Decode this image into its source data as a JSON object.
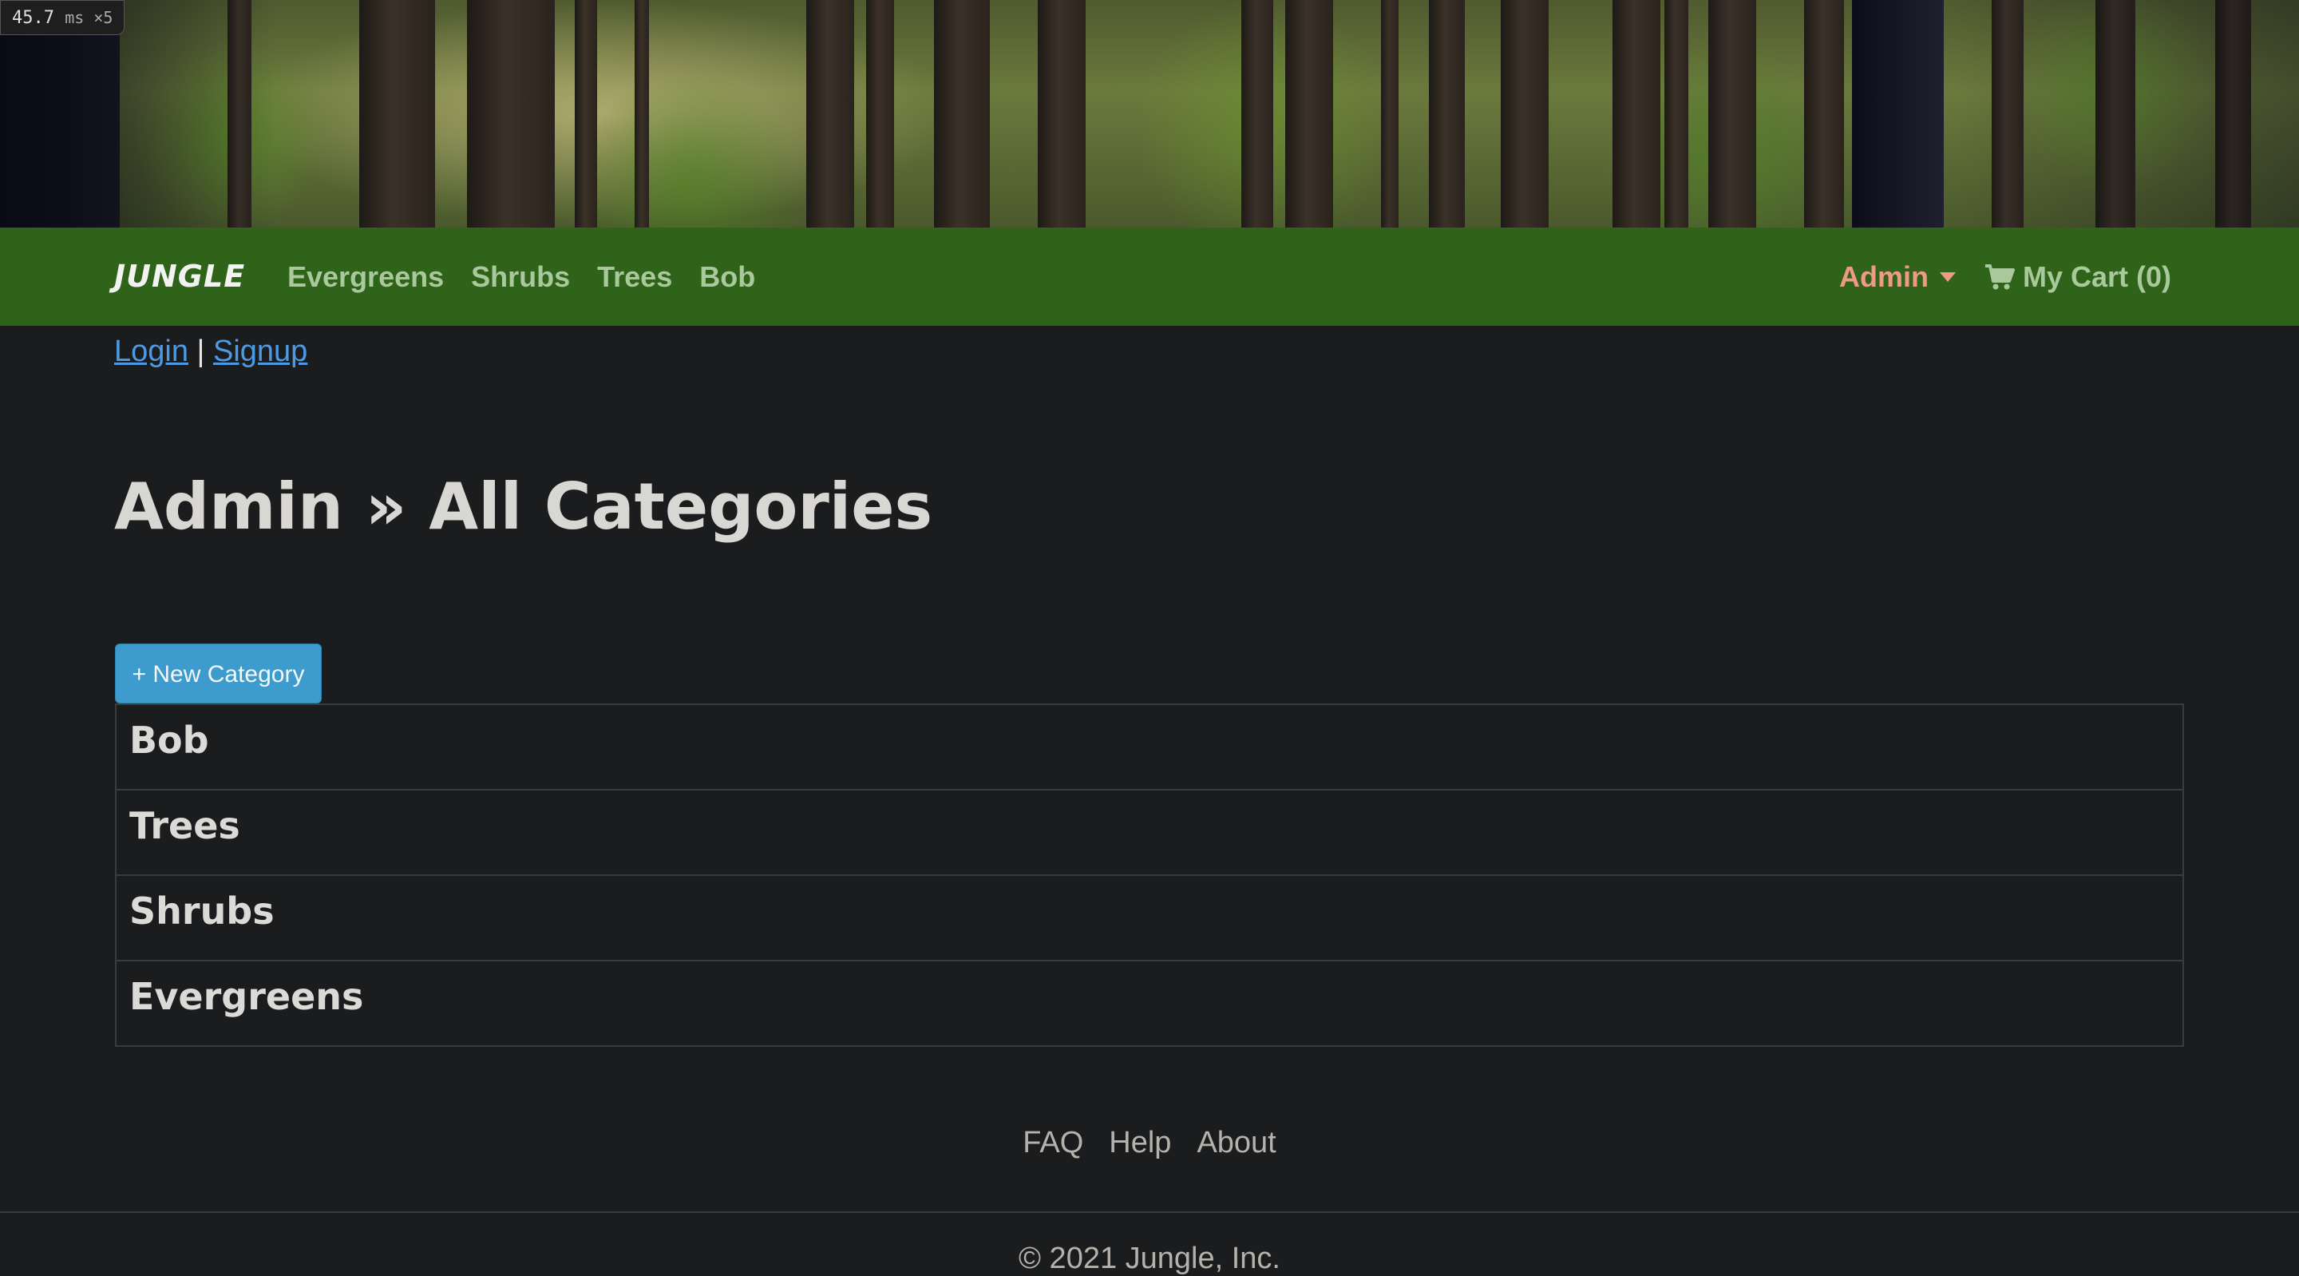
{
  "perf": {
    "value": "45.7",
    "unit": "ms ×5"
  },
  "navbar": {
    "brand": "JUNGLE",
    "links": [
      "Evergreens",
      "Shrubs",
      "Trees",
      "Bob"
    ],
    "admin_label": "Admin",
    "cart_label": "My Cart (0)",
    "bg_color": "#2e6319"
  },
  "auth": {
    "login": "Login",
    "separator": "|",
    "signup": "Signup"
  },
  "main": {
    "title": "Admin » All Categories",
    "new_button": "+ New Category",
    "categories": [
      "Bob",
      "Trees",
      "Shrubs",
      "Evergreens"
    ]
  },
  "footer": {
    "links": [
      "FAQ",
      "Help",
      "About"
    ],
    "copyright": "© 2021 Jungle, Inc."
  }
}
